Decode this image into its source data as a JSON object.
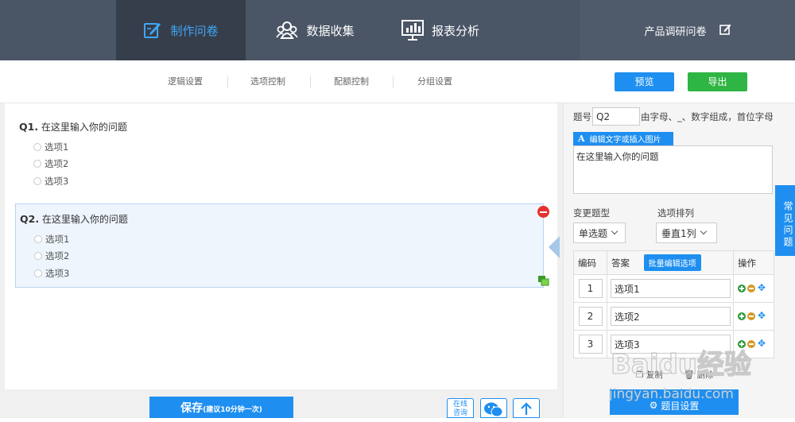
{
  "nav": {
    "items": [
      {
        "label": "制作问卷",
        "icon": "edit-icon",
        "active": true
      },
      {
        "label": "数据收集",
        "icon": "group-icon",
        "active": false
      },
      {
        "label": "报表分析",
        "icon": "chart-icon",
        "active": false
      }
    ],
    "survey_name": "产品调研问卷",
    "active_color": "#3fa6f5"
  },
  "subbar": {
    "links": [
      "逻辑设置",
      "选项控制",
      "配额控制",
      "分组设置"
    ],
    "preview_label": "预览",
    "export_label": "导出"
  },
  "questions": [
    {
      "number": "Q1.",
      "title": "在这里输入你的问题",
      "options": [
        "选项1",
        "选项2",
        "选项3"
      ]
    },
    {
      "number": "Q2.",
      "title": "在这里输入你的问题",
      "options": [
        "选项1",
        "选项2",
        "选项3"
      ],
      "selected": true
    }
  ],
  "bottom": {
    "save_label": "保存",
    "save_hint": "(建议10分钟一次)",
    "online_label_1": "在线",
    "online_label_2": "咨询"
  },
  "panel": {
    "qid_label": "题号",
    "qid_value": "Q2",
    "qid_hint": "由字母、_、数字组成，首位字母",
    "edit_tag_letter": "A",
    "edit_tag_label": "编辑文字或插入图片",
    "question_text": "在这里输入你的问题",
    "type_label": "变更题型",
    "type_value": "单选题",
    "layout_label": "选项排列",
    "layout_value": "垂直1列",
    "table": {
      "col_code": "编码",
      "col_answer": "答案",
      "batch_label": "批量编辑选项",
      "col_ops": "操作",
      "rows": [
        {
          "code": "1",
          "answer": "选项1"
        },
        {
          "code": "2",
          "answer": "选项2"
        },
        {
          "code": "3",
          "answer": "选项3"
        }
      ]
    },
    "copy_label": "复制",
    "delete_label": "删除",
    "settings_label": "题目设置"
  },
  "faq_label": "常见问题",
  "watermark_text": "Baidu经验",
  "watermark_url": "jingyan.baidu.com"
}
